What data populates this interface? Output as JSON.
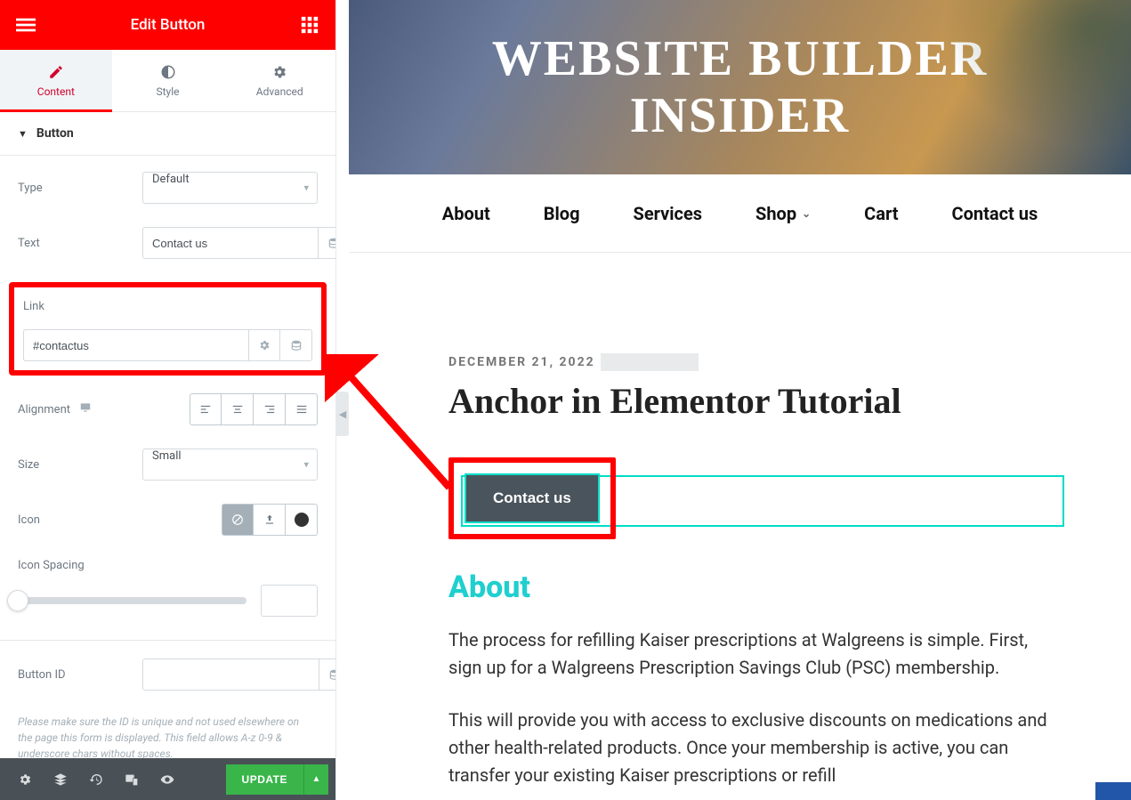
{
  "sidebar": {
    "header_title": "Edit Button",
    "tabs": {
      "content": "Content",
      "style": "Style",
      "advanced": "Advanced"
    },
    "section_title": "Button",
    "type_label": "Type",
    "type_value": "Default",
    "text_label": "Text",
    "text_value": "Contact us",
    "link_label": "Link",
    "link_value": "#contactus",
    "alignment_label": "Alignment",
    "size_label": "Size",
    "size_value": "Small",
    "icon_label": "Icon",
    "icon_spacing_label": "Icon Spacing",
    "button_id_label": "Button ID",
    "button_id_value": "",
    "help_text": "Please make sure the ID is unique and not used elsewhere on the page this form is displayed. This field allows A-z 0-9 & underscore chars without spaces.",
    "update_label": "UPDATE"
  },
  "preview": {
    "hero_title": "WEBSITE BUILDER INSIDER",
    "nav": [
      "About",
      "Blog",
      "Services",
      "Shop",
      "Cart",
      "Contact us"
    ],
    "date": "DECEMBER 21, 2022",
    "heading": "Anchor in Elementor Tutorial",
    "button_text": "Contact us",
    "about_heading": "About",
    "para1": "The process for refilling Kaiser prescriptions at Walgreens is simple. First, sign up for a Walgreens Prescription Savings Club (PSC) membership.",
    "para2": "This will provide you with access to exclusive discounts on medications and other health-related products. Once your membership is active, you can transfer your existing Kaiser prescriptions or refill"
  }
}
